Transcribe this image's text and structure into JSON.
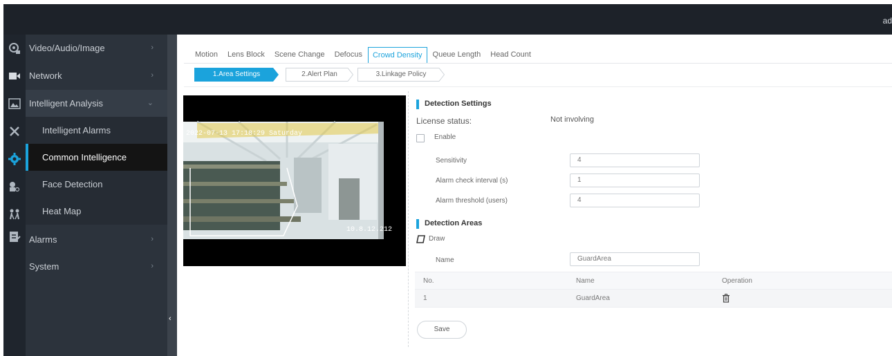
{
  "header": {
    "user": "ad"
  },
  "sidebar": {
    "items": [
      {
        "label": "Video/Audio/Image",
        "icon": "camera-settings-icon"
      },
      {
        "label": "Network",
        "icon": "network-icon"
      },
      {
        "label": "Intelligent Analysis",
        "icon": "image-icon"
      },
      {
        "label": "Alarms",
        "icon": "alarm-icon"
      },
      {
        "label": "System",
        "icon": "system-icon"
      }
    ],
    "sub_items": [
      {
        "label": "Intelligent Alarms",
        "icon": "tools-icon"
      },
      {
        "label": "Common Intelligence",
        "icon": "gear-icon"
      },
      {
        "label": "Face Detection",
        "icon": "face-search-icon"
      },
      {
        "label": "Heat Map",
        "icon": "people-icon"
      }
    ],
    "extra_icon": "clipboard-icon"
  },
  "tabs": [
    "Motion",
    "Lens Block",
    "Scene Change",
    "Defocus",
    "Crowd Density",
    "Queue Length",
    "Head Count"
  ],
  "active_tab": "Crowd Density",
  "steps": [
    "1.Area Settings",
    "2.Alert Plan",
    "3.Linkage Policy"
  ],
  "video": {
    "timestamp": "2022-07-13 17:18:29 Saturday",
    "camera_label": "10.8.12.212"
  },
  "detection_settings": {
    "title": "Detection Settings",
    "license_label": "License status:",
    "license_value": "Not involving",
    "enable_label": "Enable",
    "sensitivity_label": "Sensitivity",
    "sensitivity_value": "4",
    "interval_label": "Alarm check interval (s)",
    "interval_value": "1",
    "threshold_label": "Alarm threshold (users)",
    "threshold_value": "4"
  },
  "detection_areas": {
    "title": "Detection Areas",
    "draw_label": "Draw",
    "name_label": "Name",
    "name_value": "GuardArea",
    "columns": [
      "No.",
      "Name",
      "Operation"
    ],
    "rows": [
      {
        "no": "1",
        "name": "GuardArea"
      }
    ]
  },
  "save_label": "Save",
  "colors": {
    "accent": "#1ba3dc",
    "sidebar_bg": "#2c333c",
    "topbar_bg": "#1d2229"
  }
}
